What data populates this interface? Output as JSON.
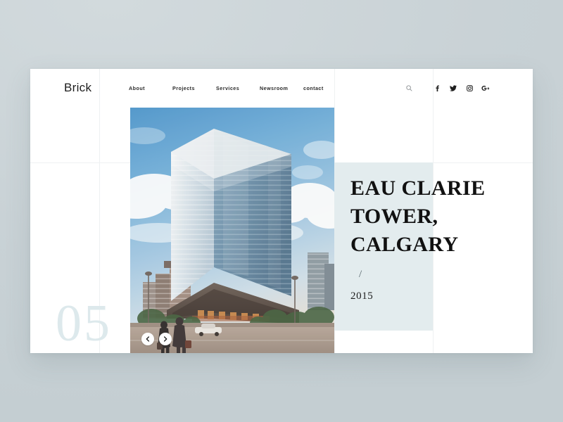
{
  "page": {
    "background_color": "#ccd5d9",
    "card_color": "#ffffff",
    "panel_color": "#e3ecee",
    "ghost_number_color": "#dde9ec"
  },
  "header": {
    "logo": "Brick",
    "nav": [
      {
        "label": "About"
      },
      {
        "label": "Projects"
      },
      {
        "label": "Services"
      },
      {
        "label": "Newsroom"
      },
      {
        "label": "contact"
      }
    ],
    "tools": [
      {
        "icon": "search-icon",
        "label": "Search"
      },
      {
        "icon": "facebook-icon",
        "label": "Facebook"
      },
      {
        "icon": "twitter-icon",
        "label": "Twitter"
      },
      {
        "icon": "instagram-icon",
        "label": "Instagram"
      },
      {
        "icon": "google-plus-icon",
        "label": "Google Plus"
      }
    ]
  },
  "slider": {
    "slide_number": "05",
    "prev_icon": "chevron-left-icon",
    "next_icon": "chevron-right-icon",
    "image_alt": "Eau Clarie Tower glass office building with blue sky and pedestrians"
  },
  "project": {
    "title": "EAU CLARIE TOWER, CALGARY",
    "separator": "/",
    "year": "2015"
  }
}
